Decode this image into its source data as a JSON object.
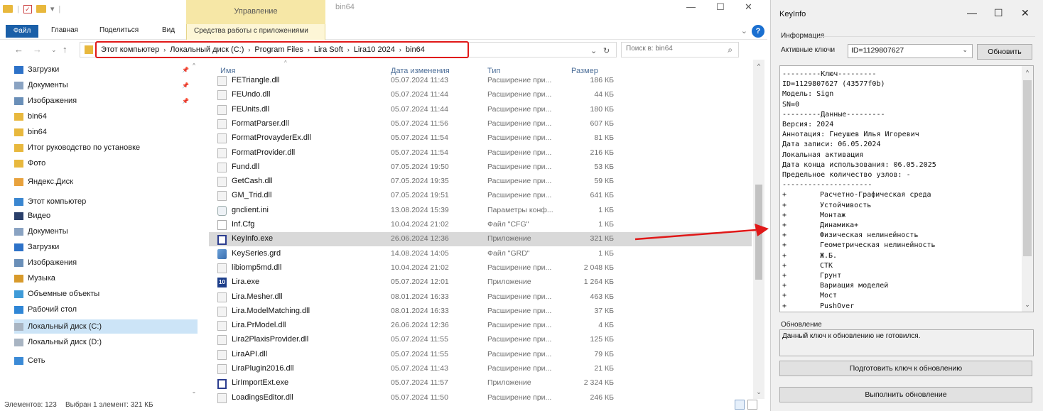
{
  "explorer": {
    "title": "bin64",
    "ribbon": {
      "context_group": "Управление",
      "tabs": [
        "Файл",
        "Главная",
        "Поделиться",
        "Вид"
      ],
      "context_tab": "Средства работы с приложениями"
    },
    "breadcrumb": [
      "Этот компьютер",
      "Локальный диск (C:)",
      "Program Files",
      "Lira Soft",
      "Lira10 2024",
      "bin64"
    ],
    "search_placeholder": "Поиск в: bin64",
    "sidebar": [
      {
        "label": "Загрузки",
        "icon": "download-icon",
        "pinned": true
      },
      {
        "label": "Документы",
        "icon": "documents-icon",
        "pinned": true
      },
      {
        "label": "Изображения",
        "icon": "pictures-icon",
        "pinned": true
      },
      {
        "label": "bin64",
        "icon": "folder-icon",
        "pinned": false
      },
      {
        "label": "bin64",
        "icon": "folder-icon",
        "pinned": false
      },
      {
        "label": "Итог руководство по установке",
        "icon": "folder-icon",
        "pinned": false
      },
      {
        "label": "Фото",
        "icon": "folder-icon",
        "pinned": false
      },
      {
        "label": "Яндекс.Диск",
        "icon": "yandex-disk-icon",
        "pinned": false
      },
      {
        "label": "Этот компьютер",
        "icon": "computer-icon",
        "pinned": false
      },
      {
        "label": "Видео",
        "icon": "video-icon",
        "pinned": false
      },
      {
        "label": "Документы",
        "icon": "documents-icon",
        "pinned": false
      },
      {
        "label": "Загрузки",
        "icon": "download-icon",
        "pinned": false
      },
      {
        "label": "Изображения",
        "icon": "pictures-icon",
        "pinned": false
      },
      {
        "label": "Музыка",
        "icon": "music-icon",
        "pinned": false
      },
      {
        "label": "Объемные объекты",
        "icon": "3d-objects-icon",
        "pinned": false
      },
      {
        "label": "Рабочий стол",
        "icon": "desktop-icon",
        "pinned": false
      },
      {
        "label": "Локальный диск (C:)",
        "icon": "drive-icon",
        "pinned": false
      },
      {
        "label": "Локальный диск (D:)",
        "icon": "drive-icon",
        "pinned": false
      },
      {
        "label": "Сеть",
        "icon": "network-icon",
        "pinned": false
      }
    ],
    "columns": {
      "name": "Имя",
      "date": "Дата изменения",
      "type": "Тип",
      "size": "Размер"
    },
    "files": [
      {
        "name": "FETriangle.dll",
        "date": "05.07.2024 11:43",
        "type": "Расширение при...",
        "size": "186 КБ",
        "icon": "dll"
      },
      {
        "name": "FEUndo.dll",
        "date": "05.07.2024 11:44",
        "type": "Расширение при...",
        "size": "44 КБ",
        "icon": "dll"
      },
      {
        "name": "FEUnits.dll",
        "date": "05.07.2024 11:44",
        "type": "Расширение при...",
        "size": "180 КБ",
        "icon": "dll"
      },
      {
        "name": "FormatParser.dll",
        "date": "05.07.2024 11:56",
        "type": "Расширение при...",
        "size": "607 КБ",
        "icon": "dll"
      },
      {
        "name": "FormatProvayderEx.dll",
        "date": "05.07.2024 11:54",
        "type": "Расширение при...",
        "size": "81 КБ",
        "icon": "dll"
      },
      {
        "name": "FormatProvider.dll",
        "date": "05.07.2024 11:54",
        "type": "Расширение при...",
        "size": "216 КБ",
        "icon": "dll"
      },
      {
        "name": "Fund.dll",
        "date": "07.05.2024 19:50",
        "type": "Расширение при...",
        "size": "53 КБ",
        "icon": "dll"
      },
      {
        "name": "GetCash.dll",
        "date": "07.05.2024 19:35",
        "type": "Расширение при...",
        "size": "59 КБ",
        "icon": "dll"
      },
      {
        "name": "GM_Trid.dll",
        "date": "07.05.2024 19:51",
        "type": "Расширение при...",
        "size": "641 КБ",
        "icon": "dll"
      },
      {
        "name": "gnclient.ini",
        "date": "13.08.2024 15:39",
        "type": "Параметры конф...",
        "size": "1 КБ",
        "icon": "ini"
      },
      {
        "name": "Inf.Cfg",
        "date": "10.04.2024 21:02",
        "type": "Файл \"CFG\"",
        "size": "1 КБ",
        "icon": "cfg"
      },
      {
        "name": "KeyInfo.exe",
        "date": "26.06.2024 12:36",
        "type": "Приложение",
        "size": "321 КБ",
        "icon": "exe",
        "selected": true
      },
      {
        "name": "KeySeries.grd",
        "date": "14.08.2024 14:05",
        "type": "Файл \"GRD\"",
        "size": "1 КБ",
        "icon": "grd"
      },
      {
        "name": "libiomp5md.dll",
        "date": "10.04.2024 21:02",
        "type": "Расширение при...",
        "size": "2 048 КБ",
        "icon": "dll"
      },
      {
        "name": "Lira.exe",
        "date": "05.07.2024 12:01",
        "type": "Приложение",
        "size": "1 264 КБ",
        "icon": "lira"
      },
      {
        "name": "Lira.Mesher.dll",
        "date": "08.01.2024 16:33",
        "type": "Расширение при...",
        "size": "463 КБ",
        "icon": "dll"
      },
      {
        "name": "Lira.ModelMatching.dll",
        "date": "08.01.2024 16:33",
        "type": "Расширение при...",
        "size": "37 КБ",
        "icon": "dll"
      },
      {
        "name": "Lira.PrModel.dll",
        "date": "26.06.2024 12:36",
        "type": "Расширение при...",
        "size": "4 КБ",
        "icon": "dll"
      },
      {
        "name": "Lira2PlaxisProvider.dll",
        "date": "05.07.2024 11:55",
        "type": "Расширение при...",
        "size": "125 КБ",
        "icon": "dll"
      },
      {
        "name": "LiraAPI.dll",
        "date": "05.07.2024 11:55",
        "type": "Расширение при...",
        "size": "79 КБ",
        "icon": "dll"
      },
      {
        "name": "LiraPlugin2016.dll",
        "date": "05.07.2024 11:43",
        "type": "Расширение при...",
        "size": "21 КБ",
        "icon": "dll"
      },
      {
        "name": "LirImportExt.exe",
        "date": "05.07.2024 11:57",
        "type": "Приложение",
        "size": "2 324 КБ",
        "icon": "exe"
      },
      {
        "name": "LoadingsEditor.dll",
        "date": "05.07.2024 11:50",
        "type": "Расширение при...",
        "size": "246 КБ",
        "icon": "dll"
      }
    ],
    "status": {
      "count": "Элементов: 123",
      "selection": "Выбран 1 элемент: 321 КБ"
    }
  },
  "keyinfo": {
    "title": "KeyInfo",
    "info_group": "Информация",
    "active_keys_label": "Активные ключи",
    "active_key": "ID=1129807627",
    "refresh_button": "Обновить",
    "text_lines": [
      "---------Ключ---------",
      "ID=1129807627 (43577f0b)",
      "Модель: Sign",
      "SN=0",
      "---------Данные---------",
      "Версия: 2024",
      "Аннотация: Гнеушев Илья Игоревич",
      "Дата записи: 06.05.2024",
      "Локальная активация",
      "Дата конца использования: 06.05.2025",
      "Предельное количество узлов: -",
      "---------------------"
    ],
    "components": [
      "Расчетно-Графическая среда",
      "Устойчивость",
      "Монтаж",
      "Динамика+",
      "Физическая нелинейность",
      "Геометрическая нелинейность",
      "Ж.Б.",
      "СТК",
      "Грунт",
      "Вариация моделей",
      "Мост",
      "PushOver"
    ],
    "update_group": "Обновление",
    "update_message": "Данный ключ к обновлению не готовился.",
    "prepare_button": "Подготовить ключ к обновлению",
    "execute_button": "Выполнить обновление"
  }
}
